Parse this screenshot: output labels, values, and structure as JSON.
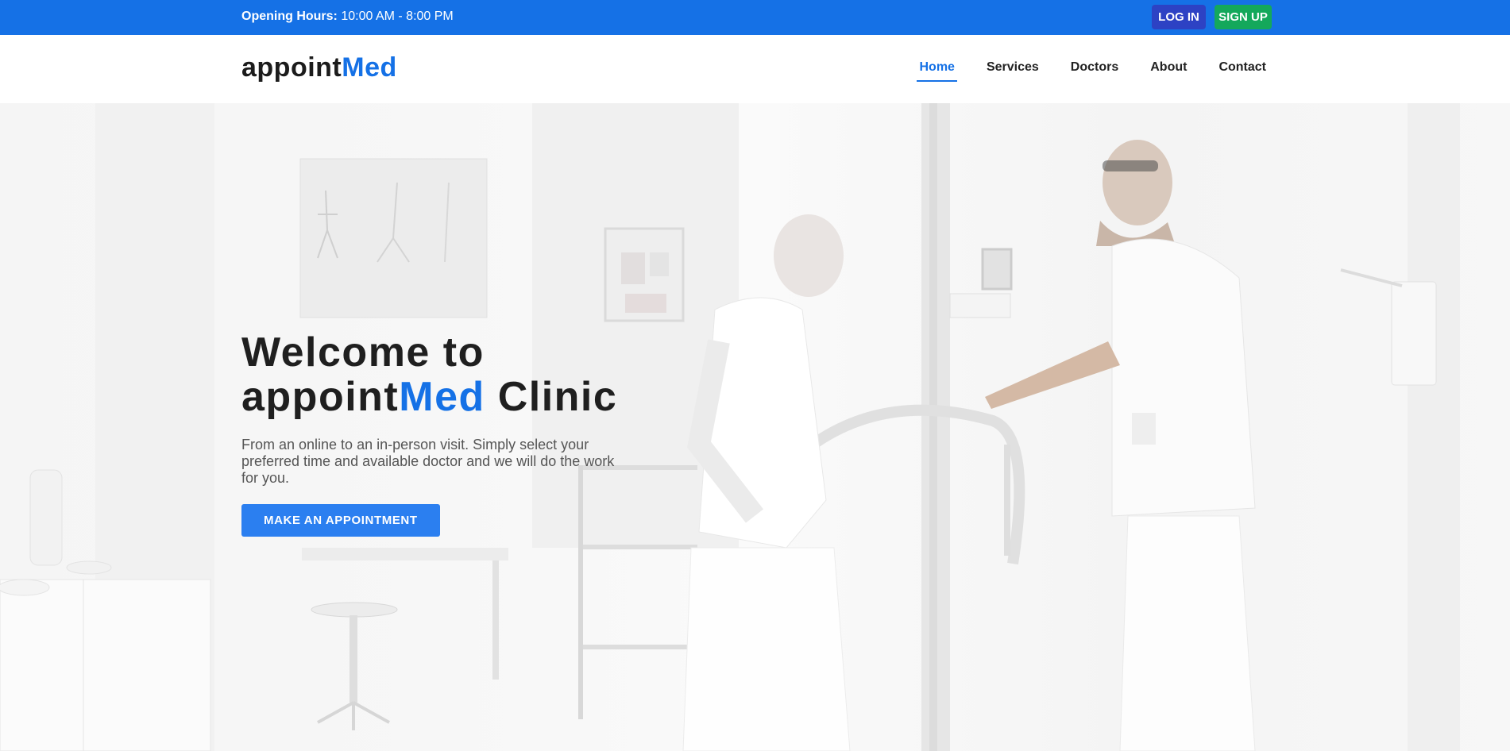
{
  "topbar": {
    "hours_label": "Opening Hours:",
    "hours_value": "10:00 AM - 8:00 PM",
    "login_label": "LOG IN",
    "signup_label": "SIGN UP"
  },
  "brand": {
    "logo_main": "appoint",
    "logo_accent": "Med"
  },
  "nav": {
    "items": [
      {
        "label": "Home",
        "active": true
      },
      {
        "label": "Services"
      },
      {
        "label": "Doctors"
      },
      {
        "label": "About"
      },
      {
        "label": "Contact"
      }
    ]
  },
  "hero": {
    "title_line1": "Welcome to",
    "title_part1": "appoint",
    "title_accent": "Med",
    "title_part2": " Clinic",
    "description": "From an online to an in-person visit. Simply select your preferred time and available doctor and we will do the work for you.",
    "cta_label": "MAKE AN APPOINTMENT"
  },
  "colors": {
    "brand_blue": "#1571e6",
    "login_button": "#2d42c4",
    "signup_button": "#14a85b",
    "cta_button": "#2b7ff0"
  }
}
